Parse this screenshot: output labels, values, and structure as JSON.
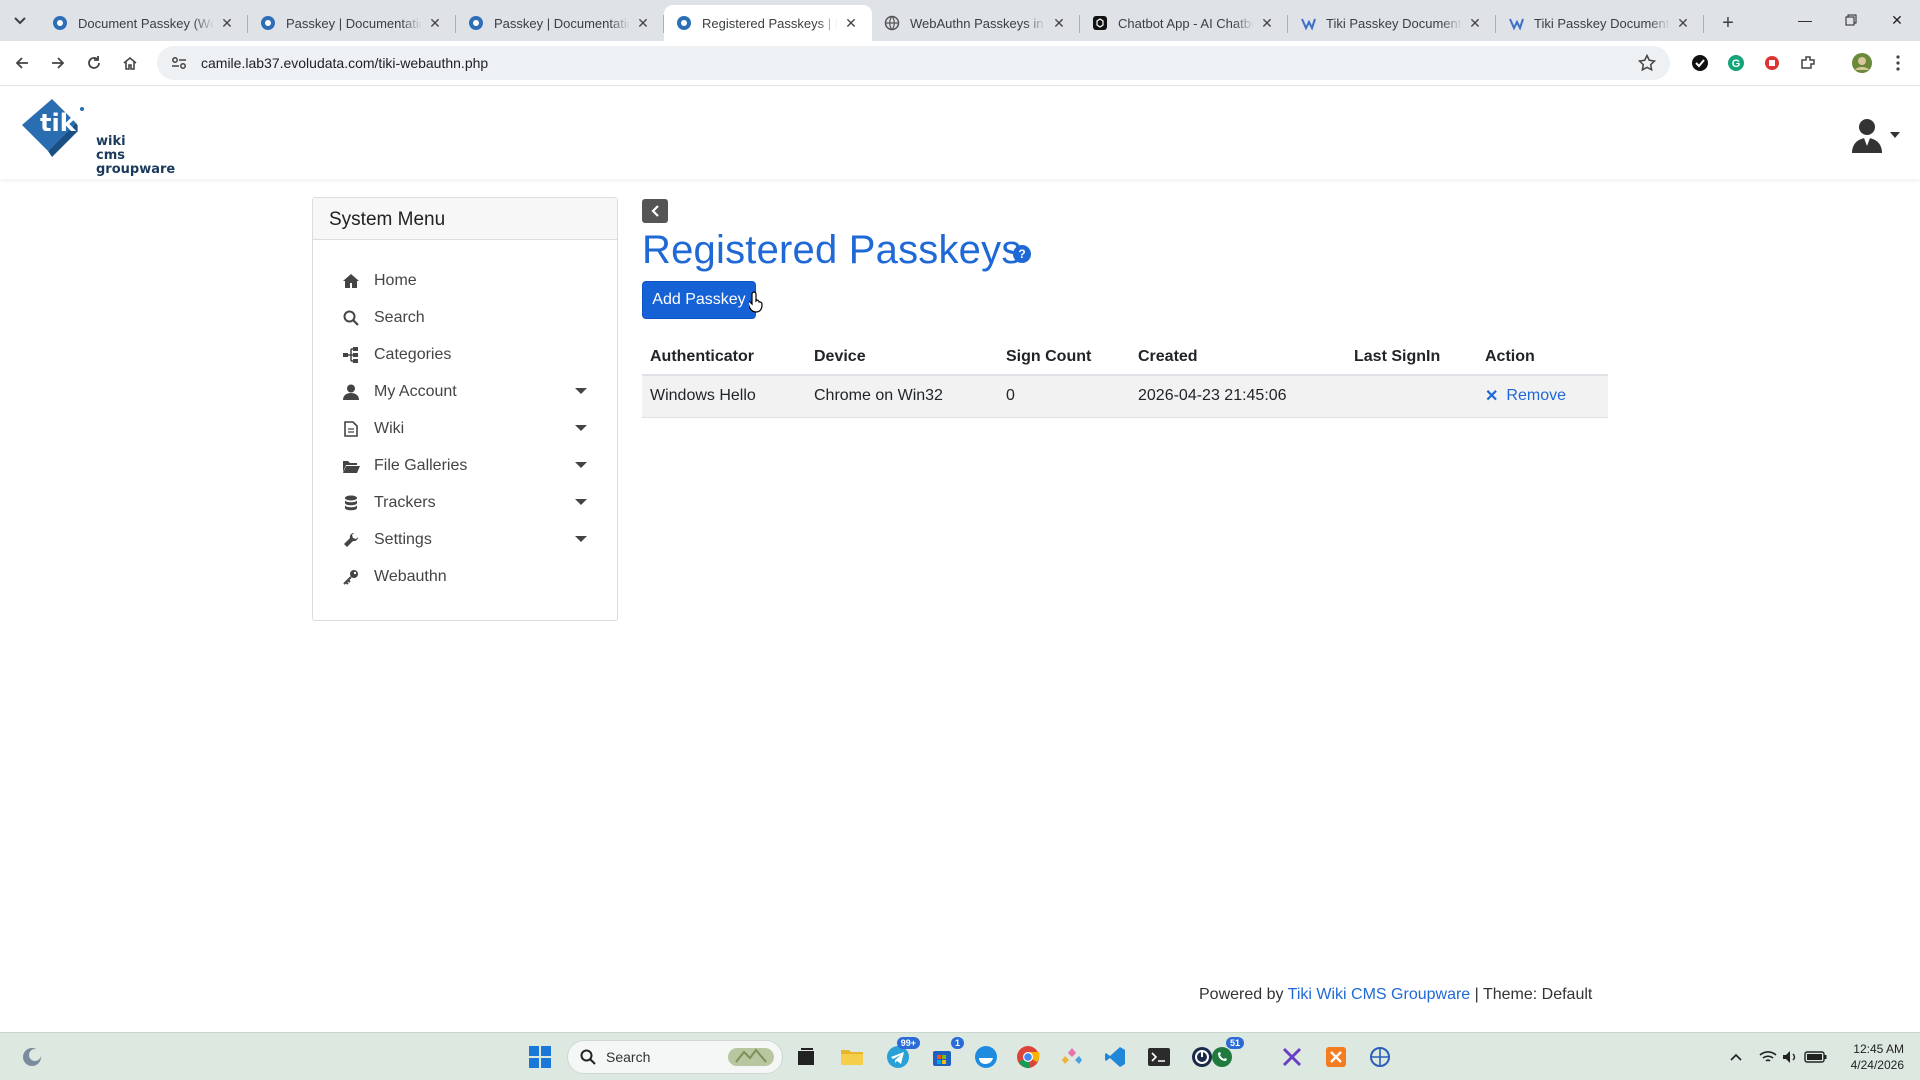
{
  "browser": {
    "tabs": [
      {
        "title": "Document Passkey (WebAuthn)",
        "active": false
      },
      {
        "title": "Passkey | Documentation",
        "active": false
      },
      {
        "title": "Passkey | Documentation",
        "active": false
      },
      {
        "title": "Registered Passkeys | My",
        "active": true
      },
      {
        "title": "WebAuthn Passkeys in Tiki",
        "active": false
      },
      {
        "title": "Chatbot App - AI Chatbot",
        "active": false
      },
      {
        "title": "Tiki Passkey Documentation",
        "active": false
      },
      {
        "title": "Tiki Passkey Documentation",
        "active": false
      }
    ],
    "url": "camile.lab37.evoludata.com/tiki-webauthn.php"
  },
  "header": {
    "logo_lines": [
      "wiki",
      "cms",
      "groupware"
    ]
  },
  "sidebar": {
    "title": "System Menu",
    "items": [
      {
        "label": "Home",
        "icon": "home-icon",
        "has_submenu": false
      },
      {
        "label": "Search",
        "icon": "search-icon",
        "has_submenu": false
      },
      {
        "label": "Categories",
        "icon": "sitemap-icon",
        "has_submenu": false
      },
      {
        "label": "My Account",
        "icon": "user-icon",
        "has_submenu": true
      },
      {
        "label": "Wiki",
        "icon": "file-icon",
        "has_submenu": true
      },
      {
        "label": "File Galleries",
        "icon": "folder-open-icon",
        "has_submenu": true
      },
      {
        "label": "Trackers",
        "icon": "database-icon",
        "has_submenu": true
      },
      {
        "label": "Settings",
        "icon": "wrench-icon",
        "has_submenu": true
      },
      {
        "label": "Webauthn",
        "icon": "key-icon",
        "has_submenu": false
      }
    ]
  },
  "main": {
    "title": "Registered Passkeys",
    "help_glyph": "?",
    "add_button": "Add Passkey",
    "table": {
      "columns": [
        "Authenticator",
        "Device",
        "Sign Count",
        "Created",
        "Last SignIn",
        "Action"
      ],
      "rows": [
        {
          "authenticator": "Windows Hello",
          "device": "Chrome on Win32",
          "sign_count": "0",
          "created": "2026-04-23 21:45:06",
          "last_signin": "",
          "action": "Remove"
        }
      ]
    }
  },
  "footer": {
    "prefix": "Powered by",
    "link": "Tiki Wiki CMS Groupware",
    "theme": "| Theme: Default"
  },
  "taskbar": {
    "search_placeholder": "Search",
    "telegram_badge": "99+",
    "store_badge": "1",
    "whatsapp_badge": "51",
    "time": "12:45 AM",
    "date": "4/24/2026"
  },
  "colors": {
    "accent": "#1f69d6",
    "button": "#1561d6",
    "tabstrip": "#dfe3e8",
    "taskbar": "#dce8e0"
  }
}
